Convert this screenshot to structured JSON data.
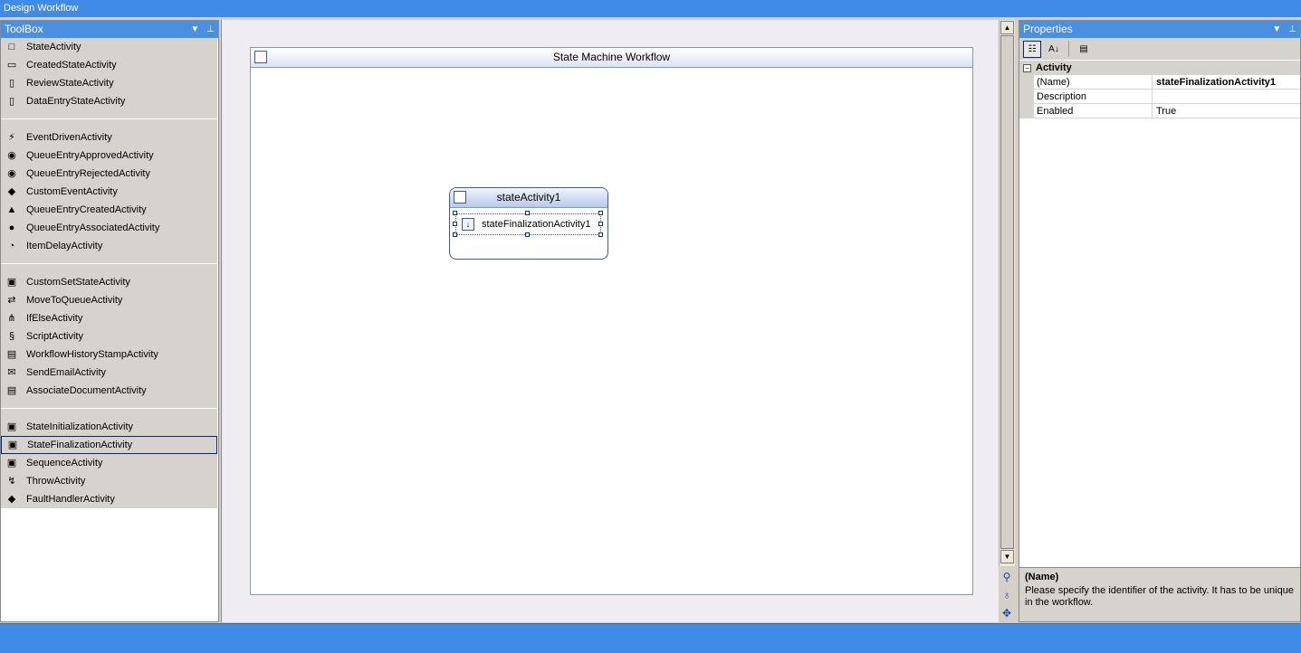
{
  "window": {
    "title": "Design Workflow"
  },
  "toolbox": {
    "title": "ToolBox",
    "groups": [
      [
        "StateActivity",
        "CreatedStateActivity",
        "ReviewStateActivity",
        "DataEntryStateActivity"
      ],
      [
        "EventDrivenActivity",
        "QueueEntryApprovedActivity",
        "QueueEntryRejectedActivity",
        "CustomEventActivity",
        "QueueEntryCreatedActivity",
        "QueueEntryAssociatedActivity",
        "ItemDelayActivity"
      ],
      [
        "CustomSetStateActivity",
        "MoveToQueueActivity",
        "IfElseActivity",
        "ScriptActivity",
        "WorkflowHistoryStampActivity",
        "SendEmailActivity",
        "AssociateDocumentActivity"
      ],
      [
        "StateInitializationActivity",
        "StateFinalizationActivity",
        "SequenceActivity",
        "ThrowActivity",
        "FaultHandlerActivity"
      ]
    ],
    "selected": "StateFinalizationActivity"
  },
  "designer": {
    "workflow_title": "State Machine Workflow",
    "state": {
      "title": "stateActivity1",
      "child": "stateFinalizationActivity1"
    }
  },
  "properties": {
    "title": "Properties",
    "category": "Activity",
    "rows": [
      {
        "name": "(Name)",
        "value": "stateFinalizationActivity1"
      },
      {
        "name": "Description",
        "value": ""
      },
      {
        "name": "Enabled",
        "value": "True"
      }
    ],
    "description": {
      "title": "(Name)",
      "text": "Please specify the identifier of the activity. It has to be unique in the workflow."
    }
  },
  "colors": {
    "titlebar": "#3f8be6",
    "panel_header": "#4a90e2",
    "selection": "#0a246a"
  }
}
